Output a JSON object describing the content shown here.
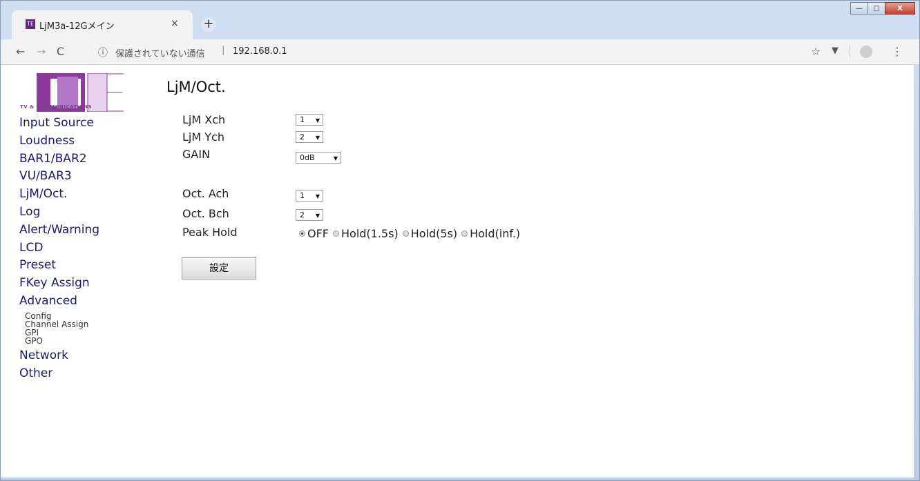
{
  "browser": {
    "tab_title": "LjM3a-12Gメイン",
    "favicon_text": "TE",
    "tab_close": "×",
    "new_tab": "+",
    "back": "←",
    "forward": "→",
    "reload": "C",
    "info_icon": "ⓘ",
    "security_text": "保護されていない通信",
    "separator": "|",
    "url": "192.168.0.1",
    "bookmark_star": "☆",
    "extension_icon": "▼",
    "menu_icon": "⋮",
    "window_minimize": "—",
    "window_maximize": "□",
    "window_close": "X"
  },
  "logo": {
    "text": "TV & COMMUNICATIONS",
    "color": "#8b3a9c"
  },
  "sidebar": {
    "items": [
      {
        "label": "Input Source"
      },
      {
        "label": "Loudness"
      },
      {
        "label": "BAR1/BAR2"
      },
      {
        "label": "VU/BAR3"
      },
      {
        "label": "LjM/Oct."
      },
      {
        "label": "Log"
      },
      {
        "label": "Alert/Warning"
      },
      {
        "label": "LCD"
      },
      {
        "label": "Preset"
      },
      {
        "label": "FKey Assign"
      },
      {
        "label": "Advanced"
      }
    ],
    "advanced_sub": [
      {
        "label": "Config"
      },
      {
        "label": "Channel Assign"
      },
      {
        "label": "GPI"
      },
      {
        "label": "GPO"
      }
    ],
    "bottom_items": [
      {
        "label": "Network"
      },
      {
        "label": "Other"
      }
    ]
  },
  "main": {
    "title": "LjM/Oct.",
    "fields": {
      "ljm_xch": {
        "label": "LjM Xch",
        "value": "1"
      },
      "ljm_ych": {
        "label": "LjM Ych",
        "value": "2"
      },
      "gain": {
        "label": "GAIN",
        "value": "0dB"
      },
      "oct_ach": {
        "label": "Oct. Ach",
        "value": "1"
      },
      "oct_bch": {
        "label": "Oct. Bch",
        "value": "2"
      }
    },
    "peak_hold": {
      "label": "Peak Hold",
      "options": [
        "OFF",
        "Hold(1.5s)",
        "Hold(5s)",
        "Hold(inf.)"
      ],
      "selected": "OFF"
    },
    "submit_label": "設定",
    "select_arrow": "▼"
  }
}
